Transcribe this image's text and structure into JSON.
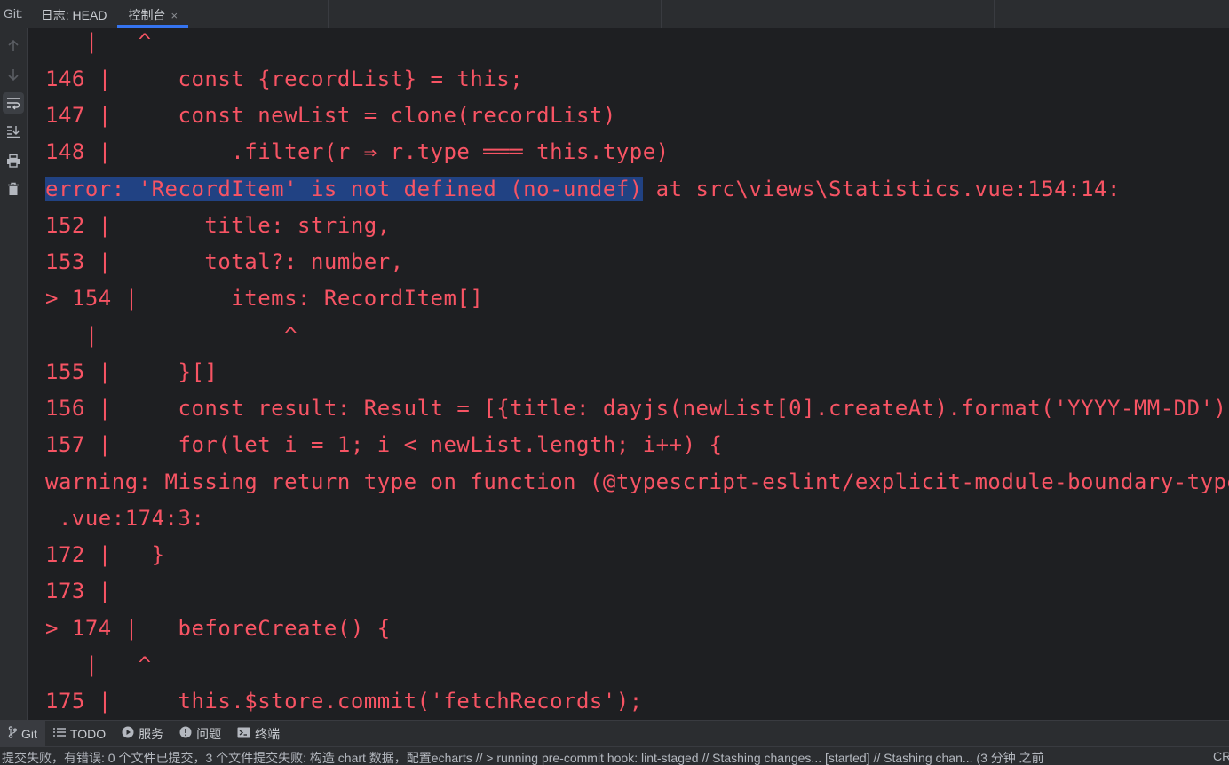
{
  "top_tabs": {
    "prefix": "Git:",
    "tabs": [
      {
        "label": "日志: HEAD"
      },
      {
        "label": "控制台",
        "close": "×"
      }
    ]
  },
  "gutter": {
    "icons": [
      "arrow-up-icon",
      "arrow-down-icon",
      "soft-wrap-icon",
      "scroll-to-end-icon",
      "print-icon",
      "trash-icon"
    ]
  },
  "console": {
    "lines": [
      "   |   ^",
      "146 |     const {recordList} = this;",
      "147 |     const newList = clone(recordList)",
      "148 |         .filter(r ⇒ r.type ═══ this.type)",
      "error: 'RecordItem' is not defined (no-undef)",
      " at src\\views\\Statistics.vue:154:14:",
      "152 |       title: string,",
      "153 |       total?: number,",
      "> 154 |       items: RecordItem[]",
      "   |              ^",
      "155 |     }[]",
      "156 |     const result: Result = [{title: dayjs(newList[0].createAt).format('YYYY-MM-DD')",
      "157 |     for(let i = 1; i < newList.length; i++) {",
      "warning: Missing return type on function (@typescript-eslint/explicit-module-boundary-types)",
      " .vue:174:3:",
      "172 |   }",
      "173 |",
      "> 174 |   beforeCreate() {",
      "   |   ^",
      "175 |     this.$store.commit('fetchRecords');"
    ],
    "text_color": "#f75464",
    "selection_color": "#214283"
  },
  "tool_windows": [
    {
      "icon": "git-branch-icon",
      "label": "Git",
      "active": true
    },
    {
      "icon": "todo-list-icon",
      "label": "TODO"
    },
    {
      "icon": "services-icon",
      "label": "服务"
    },
    {
      "icon": "problems-icon",
      "label": "问题"
    },
    {
      "icon": "terminal-icon",
      "label": "终端"
    }
  ],
  "status": {
    "message": "提交失败，有错误: 0 个文件已提交，3 个文件提交失败: 构造 chart 数据，配置echarts // > running pre-commit hook: lint-staged // Stashing changes... [started] // Stashing chan... (3 分钟 之前",
    "encoding": "CR"
  }
}
